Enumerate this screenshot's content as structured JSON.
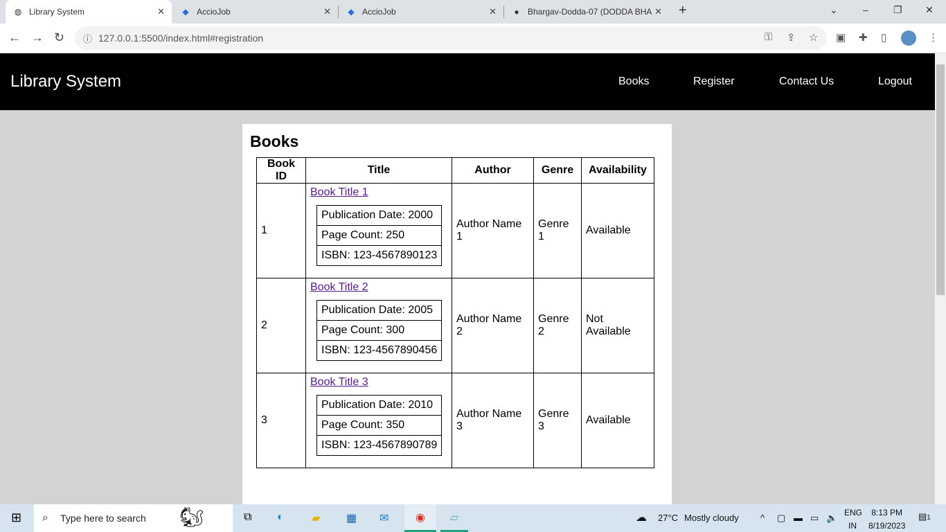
{
  "browser": {
    "tabs": [
      {
        "title": "Library System",
        "icon": "globe-icon"
      },
      {
        "title": "AccioJob",
        "icon": "acciojob-icon"
      },
      {
        "title": "AccioJob",
        "icon": "acciojob-icon"
      },
      {
        "title": "Bhargav-Dodda-07 (DODDA BHA",
        "icon": "github-icon"
      }
    ],
    "url": "127.0.0.1:5500/index.html#registration"
  },
  "navbar": {
    "brand": "Library System",
    "links": [
      "Books",
      "Register",
      "Contact Us",
      "Logout"
    ]
  },
  "books": {
    "heading": "Books",
    "headers": [
      "Book ID",
      "Title",
      "Author",
      "Genre",
      "Availability"
    ],
    "rows": [
      {
        "id": "1",
        "title": "Book Title 1",
        "details": [
          "Publication Date: 2000",
          "Page Count: 250",
          "ISBN: 123-4567890123"
        ],
        "author": "Author Name 1",
        "genre": "Genre 1",
        "availability": "Available"
      },
      {
        "id": "2",
        "title": "Book Title 2",
        "details": [
          "Publication Date: 2005",
          "Page Count: 300",
          "ISBN: 123-4567890456"
        ],
        "author": "Author Name 2",
        "genre": "Genre 2",
        "availability": "Not Available"
      },
      {
        "id": "3",
        "title": "Book Title 3",
        "details": [
          "Publication Date: 2010",
          "Page Count: 350",
          "ISBN: 123-4567890789"
        ],
        "author": "Author Name 3",
        "genre": "Genre 3",
        "availability": "Available"
      }
    ]
  },
  "taskbar": {
    "search_placeholder": "Type here to search",
    "weather_temp": "27°C",
    "weather_text": "Mostly cloudy",
    "lang": "ENG",
    "region": "IN",
    "time": "8:13 PM",
    "date": "8/19/2023",
    "notifications": "1"
  }
}
